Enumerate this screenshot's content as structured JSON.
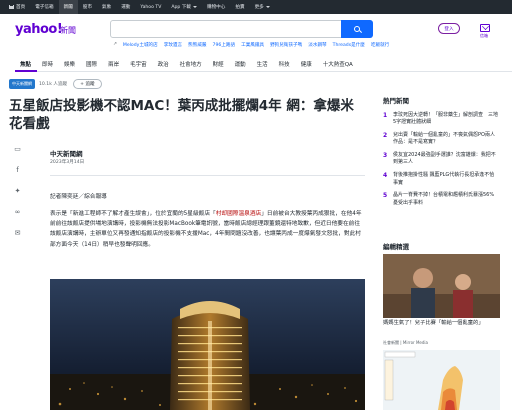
{
  "topnav": {
    "items": [
      "首頁",
      "電子信箱",
      "新聞",
      "股市",
      "氣象",
      "運動",
      "Yahoo TV",
      "App 下載",
      "購物中心",
      "拍賣",
      "更多"
    ],
    "active_index": 2
  },
  "header": {
    "logo": "yahoo!",
    "logo_sub": "新聞",
    "trending": [
      "Melody土城的店",
      "李玟遺言",
      "熊熊威嚴",
      "796上路語",
      "工業風鐵具",
      "野狗兒衛孩子嗎",
      "淡水鋼琴",
      "Threads是什麼",
      "吃飯就行"
    ],
    "login_label": "登入",
    "mail_label": "信箱"
  },
  "catnav": {
    "items": [
      "焦點",
      "即時",
      "娛樂",
      "國際",
      "兩岸",
      "毛宇宙",
      "政治",
      "社會地方",
      "財經",
      "運動",
      "生活",
      "科技",
      "健康",
      "十大熱查QA"
    ],
    "active_index": 0
  },
  "article": {
    "source_logo": "中天新聞網",
    "source_followers": "10.1k 人追蹤",
    "follow_label": "+ 追蹤",
    "headline": "五星飯店投影機不認MAC！葉丙成批擺爛4年 網：拿爆米花看戲",
    "author": "中天新聞網",
    "date": "2023年3月14日",
    "byline": "記者陳奕廷／綜合報導",
    "body_before_link": "表示是「新進工程師不了解才產生誤會」，位於宜蘭的5星級飯店「",
    "body_link": "村却國際溫泉酒店",
    "body_after_link": "」日前被台大教授葉丙成狠批，在他4年前前往該飯店提供場地演講時，投影機無法投影MacBook筆電訊號，當時飯店總經理跟董鏡還特地致歉，但近日他要在前往該飯店演講時，主辦單位又再發通知指飯店的投影機不支援Mac，4年間問題沒改善，也讓葉丙成一度爆氣發文怒批，對此村部方面今天（14日）稍早也發聲明回應。"
  },
  "sidebar": {
    "hot_title": "熱門新聞",
    "hot_items": [
      "李玟死因大逆轉！「服非藥生」解剖調查　三地5字證實壯體狀細",
      "兒出賣「輸給一個亂童的」不喪氣偶怨PO兩人作品：是不是寫實？",
      "侯友宜2024最強副手選誰？沈富雄爆：我把不到第三人",
      "背後推抱掛性騷 飄藍PLG代執行長坦承逢不恰事實",
      "晶片一脊費不掉！台積電和趨積利氏暴漲56% 憂受出乎事料"
    ],
    "editor_title": "編輯精選",
    "editor_caption": "媽媽生氣了！兒子比賽「輸給一個亂童的」",
    "editor_source": "社會新聞 | Mirror Media"
  },
  "colors": {
    "brand": "#6001d2",
    "search_button": "#0f69ff",
    "link": "#b40000"
  }
}
